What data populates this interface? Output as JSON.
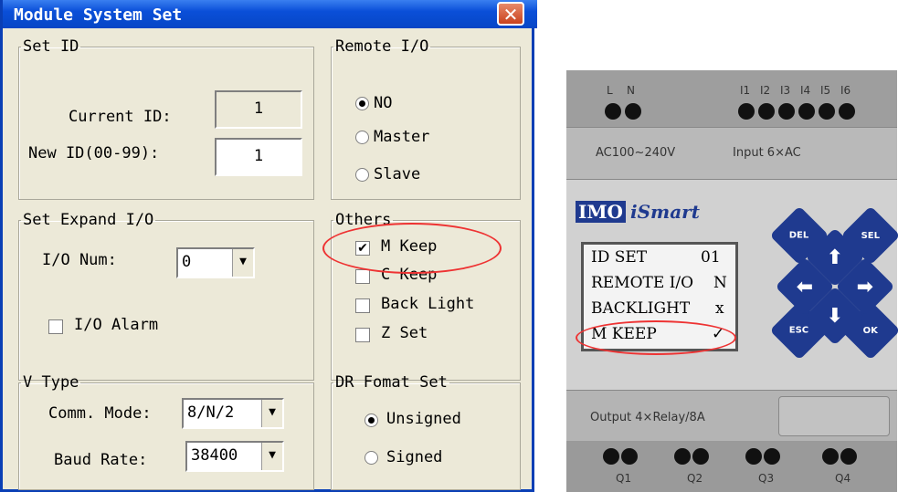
{
  "dialog": {
    "title": "Module System Set",
    "set_id": {
      "legend": "Set ID",
      "current_label": "Current ID:",
      "current_value": "1",
      "new_label": "New ID(00-99):",
      "new_value": "1"
    },
    "remote_io": {
      "legend": "Remote I/O",
      "options": [
        "NO",
        "Master",
        "Slave"
      ],
      "selected": "NO"
    },
    "expand_io": {
      "legend": "Set Expand I/O",
      "num_label": "I/O Num:",
      "num_value": "0",
      "alarm_label": "I/O Alarm",
      "alarm_checked": false
    },
    "others": {
      "legend": "Others",
      "items": [
        {
          "label": "M Keep",
          "checked": true
        },
        {
          "label": "C Keep",
          "checked": false
        },
        {
          "label": "Back Light",
          "checked": false
        },
        {
          "label": "Z Set",
          "checked": false
        }
      ]
    },
    "v_type": {
      "legend": "V Type",
      "comm_label": "Comm. Mode:",
      "comm_value": "8/N/2",
      "baud_label": "Baud Rate:",
      "baud_value": "38400"
    },
    "dr_format": {
      "legend": "DR Fomat Set",
      "options": [
        "Unsigned",
        "Signed"
      ],
      "selected": "Unsigned"
    }
  },
  "device": {
    "terminals_top": [
      "L",
      "N",
      "I1",
      "I2",
      "I3",
      "I4",
      "I5",
      "I6"
    ],
    "power_label": "AC100~240V",
    "input_label": "Input 6×AC",
    "brand_logo": "IMO",
    "brand_name": "iSmart",
    "lcd": [
      {
        "label": "ID SET",
        "value": "01"
      },
      {
        "label": "REMOTE I/O",
        "value": "N"
      },
      {
        "label": "BACKLIGHT",
        "value": "x"
      },
      {
        "label": "M KEEP",
        "value": "✓"
      }
    ],
    "keys": [
      "DEL",
      "SEL",
      "ESC",
      "OK"
    ],
    "output_label": "Output 4×Relay/8A",
    "terminals_bottom": [
      "Q1",
      "Q2",
      "Q3",
      "Q4"
    ]
  },
  "colors": {
    "titlebar": "#0a4fd8",
    "dialog_bg": "#ece9d8",
    "highlight_ellipse": "#ee3333",
    "key_blue": "#1f3a8f"
  }
}
